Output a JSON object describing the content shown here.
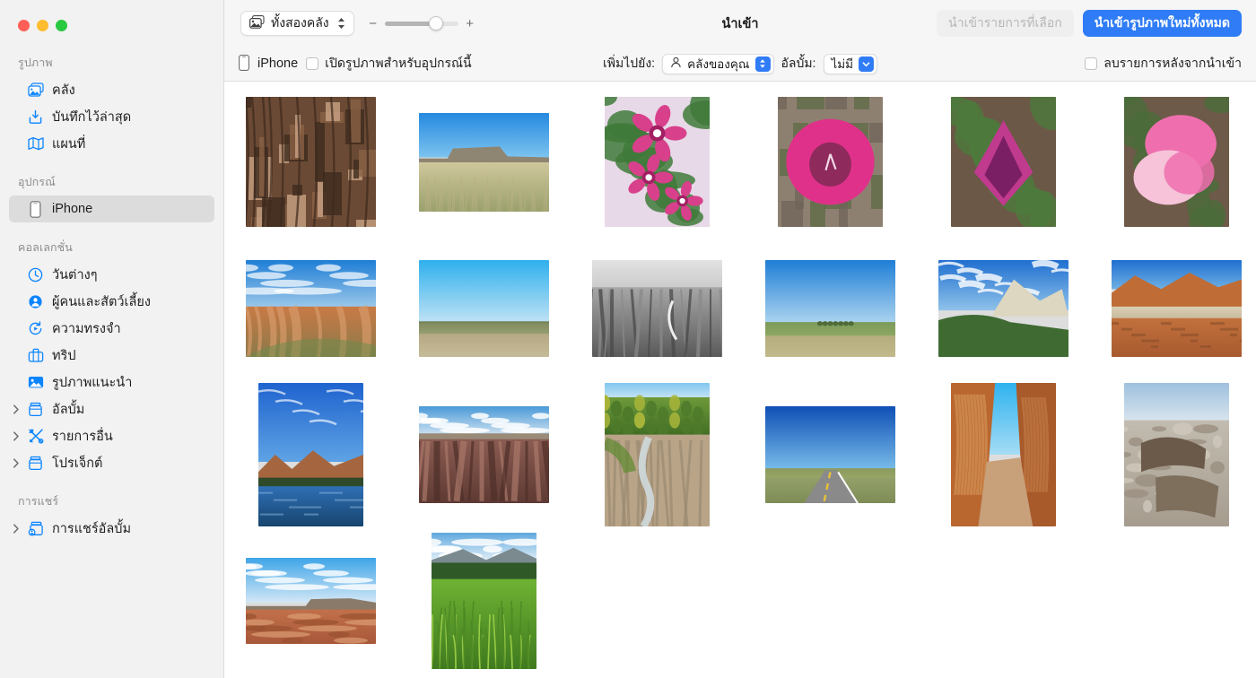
{
  "window": {
    "traffic_lights": [
      "close",
      "minimize",
      "zoom"
    ],
    "colors": {
      "close": "#ff5f57",
      "minimize": "#febc2e",
      "zoom": "#28c840",
      "accent": "#2f7cf6"
    }
  },
  "sidebar": {
    "sections": [
      {
        "title": "รูปภาพ",
        "items": [
          {
            "label": "คลัง",
            "icon": "photo-stack-icon",
            "selected": false,
            "chevron": false
          },
          {
            "label": "บันทึกไว้ล่าสุด",
            "icon": "recent-saved-icon",
            "selected": false,
            "chevron": false
          },
          {
            "label": "แผนที่",
            "icon": "map-icon",
            "selected": false,
            "chevron": false
          }
        ]
      },
      {
        "title": "อุปกรณ์",
        "items": [
          {
            "label": "iPhone",
            "icon": "iphone-icon",
            "selected": true,
            "chevron": false
          }
        ]
      },
      {
        "title": "คอลเลกชั่น",
        "items": [
          {
            "label": "วันต่างๆ",
            "icon": "clock-icon",
            "selected": false,
            "chevron": false
          },
          {
            "label": "ผู้คนและสัตว์เลี้ยง",
            "icon": "person-circle-icon",
            "selected": false,
            "chevron": false
          },
          {
            "label": "ความทรงจำ",
            "icon": "memories-icon",
            "selected": false,
            "chevron": false
          },
          {
            "label": "ทริป",
            "icon": "suitcase-icon",
            "selected": false,
            "chevron": false
          },
          {
            "label": "รูปภาพแนะนำ",
            "icon": "featured-photo-icon",
            "selected": false,
            "chevron": false
          },
          {
            "label": "อัลบั้ม",
            "icon": "album-icon",
            "selected": false,
            "chevron": true
          },
          {
            "label": "รายการอื่น",
            "icon": "tools-icon",
            "selected": false,
            "chevron": true
          },
          {
            "label": "โปรเจ็กต์",
            "icon": "project-icon",
            "selected": false,
            "chevron": true
          }
        ]
      },
      {
        "title": "การแชร์",
        "items": [
          {
            "label": "การแชร์อัลบั้ม",
            "icon": "shared-album-icon",
            "selected": false,
            "chevron": true
          }
        ]
      }
    ]
  },
  "toolbar": {
    "library_popup_label": "ทั้งสองคลัง",
    "library_popup_icon": "photo-stack-icon",
    "zoom_out_label": "−",
    "zoom_in_label": "+",
    "zoom_value_percent": 70,
    "title": "นำเข้า",
    "import_selected_label": "นำเข้ารายการที่เลือก",
    "import_selected_enabled": false,
    "import_all_label": "นำเข้ารูปภาพใหม่ทั้งหมด"
  },
  "subbar": {
    "device_icon": "iphone-icon",
    "device_name": "iPhone",
    "open_photos_checkbox_label": "เปิดรูปภาพสำหรับอุปกรณ์นี้",
    "open_photos_checked": false,
    "add_to_label": "เพิ่มไปยัง:",
    "add_to_value": "คลังของคุณ",
    "add_to_icon": "person-icon",
    "album_label": "อัลบั้ม:",
    "album_value": "ไม่มี",
    "delete_after_import_label": "ลบรายการหลังจากนำเข้า",
    "delete_after_import_checked": false
  },
  "grid": {
    "columns": 6,
    "rows": [
      [
        {
          "name": "tree-bark-closeup",
          "orientation": "portrait",
          "w": 145,
          "h": 145,
          "pal": [
            "#6b4a35",
            "#3d2a1e",
            "#c9a183",
            "#8a6245"
          ],
          "kind": "bark"
        },
        {
          "name": "grass-field-butte",
          "orientation": "landscape",
          "w": 145,
          "h": 110,
          "pal": [
            "#2e9ae0",
            "#c6c39a",
            "#a9a77c",
            "#8e9a6a"
          ],
          "kind": "butte"
        },
        {
          "name": "pink-orchid-flowers",
          "orientation": "portrait",
          "w": 117,
          "h": 145,
          "pal": [
            "#d8408b",
            "#a31f63",
            "#3f7a3a",
            "#e7d9e8"
          ],
          "kind": "orchid"
        },
        {
          "name": "pink-tulip-flower",
          "orientation": "portrait",
          "w": 117,
          "h": 145,
          "pal": [
            "#e0318a",
            "#8e2a5c",
            "#8e8070",
            "#5c6b46"
          ],
          "kind": "tulip"
        },
        {
          "name": "purple-mariposa-lily",
          "orientation": "portrait",
          "w": 117,
          "h": 145,
          "pal": [
            "#7b1f64",
            "#c03a8e",
            "#4d7a3c",
            "#6b5847"
          ],
          "kind": "lily"
        },
        {
          "name": "pink-sweetpea-blossom",
          "orientation": "portrait",
          "w": 117,
          "h": 145,
          "pal": [
            "#ef6fae",
            "#f6c3d9",
            "#4b6b3b",
            "#6d5a48"
          ],
          "kind": "sweetpea"
        }
      ],
      [
        {
          "name": "bryce-canyon-hoodoos",
          "orientation": "landscape",
          "w": 145,
          "h": 108,
          "pal": [
            "#2f86d8",
            "#e8f1fb",
            "#c6733f",
            "#6f8a4a"
          ],
          "kind": "canyon-blue"
        },
        {
          "name": "prairie-wide-sky",
          "orientation": "landscape",
          "w": 145,
          "h": 108,
          "pal": [
            "#2fb3ef",
            "#9ec6e8",
            "#b9ab86",
            "#7e8a5e"
          ],
          "kind": "prairie"
        },
        {
          "name": "badlands-black-and-white",
          "orientation": "landscape",
          "w": 145,
          "h": 108,
          "pal": [
            "#d8d8d8",
            "#9a9a9a",
            "#6b6b6b",
            "#454545"
          ],
          "kind": "bw"
        },
        {
          "name": "green-field-horizon",
          "orientation": "landscape",
          "w": 145,
          "h": 108,
          "pal": [
            "#1f7ed6",
            "#8fc4ea",
            "#7d9a5a",
            "#b5ad7c"
          ],
          "kind": "field"
        },
        {
          "name": "zion-white-cliffs",
          "orientation": "landscape",
          "w": 145,
          "h": 108,
          "pal": [
            "#1f6fd0",
            "#e8eef4",
            "#c9bda0",
            "#3f6b33"
          ],
          "kind": "cliffs"
        },
        {
          "name": "capitol-reef-red-rock",
          "orientation": "landscape",
          "w": 145,
          "h": 108,
          "pal": [
            "#1f6fd0",
            "#b9622f",
            "#d7a271",
            "#8a6a4a"
          ],
          "kind": "redrock"
        }
      ],
      [
        {
          "name": "canyonlands-river-reflection",
          "orientation": "portrait",
          "w": 117,
          "h": 160,
          "pal": [
            "#1f63cf",
            "#2f86e0",
            "#a5663f",
            "#14406b"
          ],
          "kind": "river"
        },
        {
          "name": "grand-canyon-overlook",
          "orientation": "landscape",
          "w": 145,
          "h": 108,
          "pal": [
            "#4a9ad8",
            "#e3eaf2",
            "#8a5c52",
            "#6b4238"
          ],
          "kind": "grandcanyon"
        },
        {
          "name": "creek-through-badlands",
          "orientation": "portrait",
          "w": 117,
          "h": 160,
          "pal": [
            "#7ea83f",
            "#4e7a2f",
            "#b9a488",
            "#8a7a68"
          ],
          "kind": "creek"
        },
        {
          "name": "highway-through-prairie",
          "orientation": "landscape",
          "w": 145,
          "h": 108,
          "pal": [
            "#0f4fb5",
            "#2f86e0",
            "#8a9a5e",
            "#7a7a7a"
          ],
          "kind": "road"
        },
        {
          "name": "slot-canyon-dirt-road",
          "orientation": "portrait",
          "w": 117,
          "h": 160,
          "pal": [
            "#2fb3ef",
            "#b9672f",
            "#d79a5e",
            "#9a7a5e"
          ],
          "kind": "slotcanyon"
        },
        {
          "name": "petrified-wood-logs",
          "orientation": "portrait",
          "w": 117,
          "h": 160,
          "pal": [
            "#9ec0de",
            "#c6c0b5",
            "#6b5a4a",
            "#8a7a6a"
          ],
          "kind": "petrified"
        }
      ],
      [
        {
          "name": "painted-desert-badlands",
          "orientation": "landscape",
          "w": 145,
          "h": 96,
          "pal": [
            "#3fa5e8",
            "#cfe4f4",
            "#b5613f",
            "#c98a6a"
          ],
          "kind": "desert"
        },
        {
          "name": "tall-green-grass-meadow",
          "orientation": "portrait",
          "w": 117,
          "h": 152,
          "pal": [
            "#5ea8de",
            "#e8f0f6",
            "#5e9a2f",
            "#3f6b1f"
          ],
          "kind": "meadow"
        }
      ]
    ]
  }
}
